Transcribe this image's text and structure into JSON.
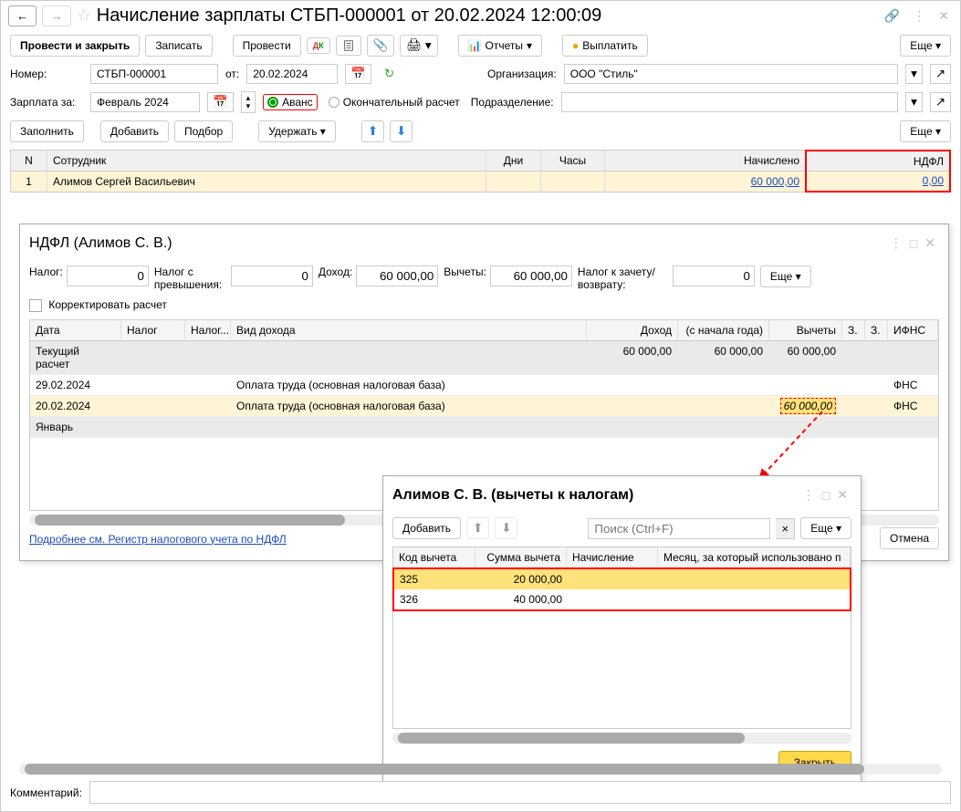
{
  "window": {
    "title": "Начисление зарплаты СТБП-000001 от 20.02.2024 12:00:09"
  },
  "toolbar": {
    "post_close": "Провести и закрыть",
    "write": "Записать",
    "post": "Провести",
    "reports": "Отчеты",
    "pay": "Выплатить",
    "more": "Еще"
  },
  "form": {
    "number_label": "Номер:",
    "number": "СТБП-000001",
    "from_label": "от:",
    "date": "20.02.2024",
    "org_label": "Организация:",
    "org": "ООО \"Стиль\"",
    "salary_for_label": "Зарплата за:",
    "salary_for": "Февраль 2024",
    "advance": "Аванс",
    "final": "Окончательный расчет",
    "division_label": "Подразделение:",
    "division": ""
  },
  "actions": {
    "fill": "Заполнить",
    "add": "Добавить",
    "select": "Подбор",
    "withhold": "Удержать",
    "more": "Еще"
  },
  "main_table": {
    "headers": {
      "n": "N",
      "emp": "Сотрудник",
      "days": "Дни",
      "hours": "Часы",
      "accrued": "Начислено",
      "ndfl": "НДФЛ"
    },
    "rows": [
      {
        "n": "1",
        "emp": "Алимов Сергей Васильевич",
        "days": "",
        "hours": "",
        "accrued": "60 000,00",
        "ndfl": "0,00"
      }
    ]
  },
  "ndfl_modal": {
    "title": "НДФЛ (Алимов С. В.)",
    "tax_label": "Налог:",
    "tax": "0",
    "exceed_label": "Налог с превышения:",
    "exceed": "0",
    "income_label": "Доход:",
    "income": "60 000,00",
    "deductions_label": "Вычеты:",
    "deductions": "60 000,00",
    "credit_label": "Налог к зачету/возврату:",
    "credit": "0",
    "more": "Еще",
    "correct_label": "Корректировать расчет",
    "headers": {
      "date": "Дата",
      "tax": "Налог",
      "tax2": "Налог...",
      "type": "Вид дохода",
      "income": "Доход",
      "ytd": "(с начала года)",
      "ded": "Вычеты",
      "z1": "З.",
      "z2": "З.",
      "ifns": "ИФНС"
    },
    "rows": [
      {
        "kind": "group",
        "label": "Текущий расчет",
        "income": "60 000,00",
        "ytd": "60 000,00",
        "ded": "60 000,00"
      },
      {
        "kind": "row",
        "date": "29.02.2024",
        "type": "Оплата труда (основная налоговая база)",
        "ifns": "ФНС"
      },
      {
        "kind": "row-cream",
        "date": "20.02.2024",
        "type": "Оплата труда (основная налоговая база)",
        "ded": "60 000,00",
        "ifns": "ФНС"
      },
      {
        "kind": "group",
        "label": "Январь"
      }
    ],
    "link": "Подробнее см. Регистр налогового учета по НДФЛ",
    "cancel": "Отмена"
  },
  "deductions_modal": {
    "title": "Алимов С. В. (вычеты к налогам)",
    "add": "Добавить",
    "search_placeholder": "Поиск (Ctrl+F)",
    "more": "Еще",
    "headers": {
      "code": "Код вычета",
      "sum": "Сумма вычета",
      "acc": "Начисление",
      "month": "Месяц, за который использовано п"
    },
    "rows": [
      {
        "code": "325",
        "sum": "20 000,00"
      },
      {
        "code": "326",
        "sum": "40 000,00"
      }
    ],
    "close": "Закрыть"
  },
  "footer": {
    "comment_label": "Комментарий:"
  }
}
